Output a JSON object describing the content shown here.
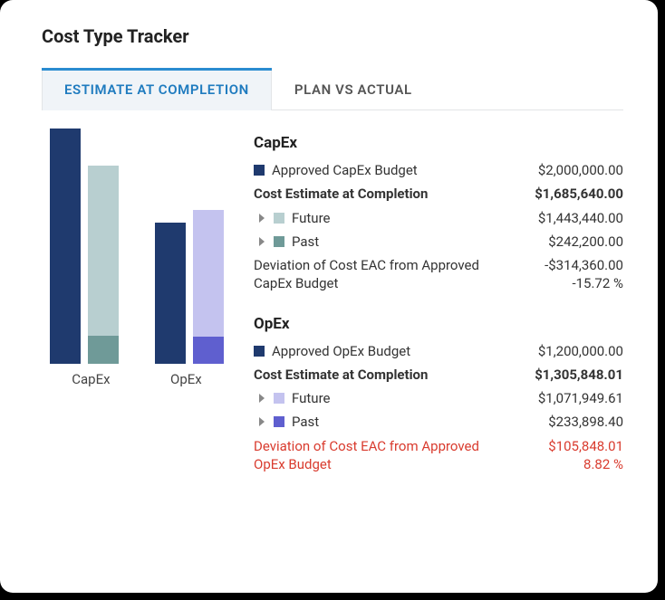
{
  "title": "Cost Type Tracker",
  "tabs": {
    "active": "ESTIMATE AT COMPLETION",
    "inactive": "PLAN VS ACTUAL"
  },
  "colors": {
    "approved": "#1f3a6e",
    "capex_future": "#b8cfd0",
    "capex_past": "#6f9a98",
    "opex_future": "#c4c3ef",
    "opex_past": "#5f5fcf"
  },
  "capex": {
    "title": "CapEx",
    "approved_label": "Approved CapEx Budget",
    "approved_value": "$2,000,000.00",
    "eac_label": "Cost Estimate at Completion",
    "eac_value": "$1,685,640.00",
    "future_label": "Future",
    "future_value": "$1,443,440.00",
    "past_label": "Past",
    "past_value": "$242,200.00",
    "dev_label": "Deviation of Cost EAC from Approved CapEx Budget",
    "dev_value": "-$314,360.00",
    "dev_pct": "-15.72 %"
  },
  "opex": {
    "title": "OpEx",
    "approved_label": "Approved OpEx Budget",
    "approved_value": "$1,200,000.00",
    "eac_label": "Cost Estimate at Completion",
    "eac_value": "$1,305,848.01",
    "future_label": "Future",
    "future_value": "$1,071,949.61",
    "past_label": "Past",
    "past_value": "$233,898.40",
    "dev_label": "Deviation of Cost EAC from Approved OpEx Budget",
    "dev_value": "$105,848.01",
    "dev_pct": "8.82 %"
  },
  "chart_data": {
    "type": "bar",
    "categories": [
      "CapEx",
      "OpEx"
    ],
    "ylim": [
      0,
      2000000
    ],
    "series": [
      {
        "name": "Approved Budget",
        "values": [
          2000000,
          1200000
        ],
        "color": "#1f3a6e"
      },
      {
        "name": "Cost Estimate at Completion",
        "stacked": true,
        "components": [
          {
            "name": "Past",
            "values": [
              242200,
              233898.4
            ],
            "colors": [
              "#6f9a98",
              "#5f5fcf"
            ]
          },
          {
            "name": "Future",
            "values": [
              1443440,
              1071949.61
            ],
            "colors": [
              "#b8cfd0",
              "#c4c3ef"
            ]
          }
        ]
      }
    ]
  }
}
